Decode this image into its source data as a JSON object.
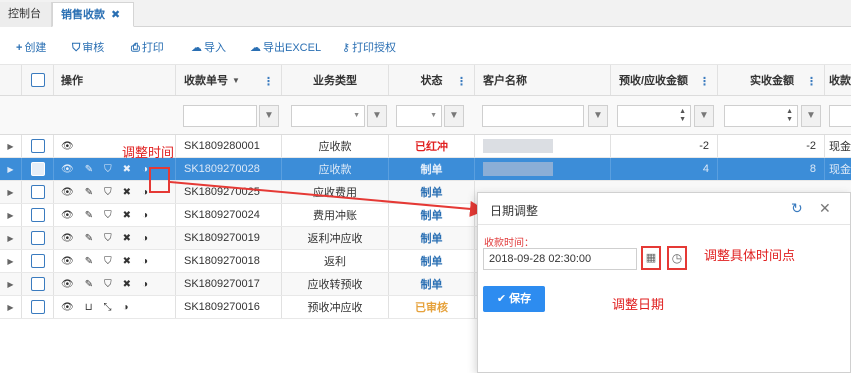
{
  "tabs": [
    {
      "label": "控制台"
    },
    {
      "label": "销售收款",
      "close": "✖"
    }
  ],
  "toolbar": {
    "create": "创建",
    "audit": "审核",
    "print": "打印",
    "import": "导入",
    "export": "导出EXCEL",
    "print_auth": "打印授权"
  },
  "columns": {
    "ops": "操作",
    "no": "收款单号",
    "type": "业务类型",
    "status": "状态",
    "customer": "客户名称",
    "due": "预收/应收金额",
    "paid": "实收金额",
    "more": "收款"
  },
  "rows": [
    {
      "no": "SK1809280001",
      "type": "应收款",
      "status": "已红冲",
      "status_color": "#e02020",
      "due": "-2",
      "paid": "-2",
      "more": "现金"
    },
    {
      "no": "SK1809270028",
      "type": "应收款",
      "status": "制单",
      "status_color": "#2a6fb3",
      "due": "4",
      "paid": "8",
      "more": "现金"
    },
    {
      "no": "SK1809270025",
      "type": "应收费用",
      "status": "制单",
      "status_color": "#2a6fb3"
    },
    {
      "no": "SK1809270024",
      "type": "费用冲账",
      "status": "制单",
      "status_color": "#2a6fb3"
    },
    {
      "no": "SK1809270019",
      "type": "返利冲应收",
      "status": "制单",
      "status_color": "#2a6fb3"
    },
    {
      "no": "SK1809270018",
      "type": "返利",
      "status": "制单",
      "status_color": "#2a6fb3"
    },
    {
      "no": "SK1809270017",
      "type": "应收转预收",
      "status": "制单",
      "status_color": "#2a6fb3"
    },
    {
      "no": "SK1809270016",
      "type": "预收冲应收",
      "status": "已审核",
      "status_color": "#e6a23c"
    }
  ],
  "dialog": {
    "title": "日期调整",
    "label": "收款时间：",
    "value": "2018-09-28 02:30:00",
    "save": "保存"
  },
  "annotations": {
    "adjust_time": "调整时间",
    "adjust_clock": "调整具体时间点",
    "adjust_date": "调整日期"
  }
}
